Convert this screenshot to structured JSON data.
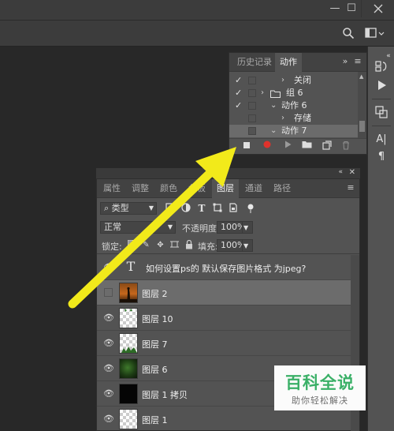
{
  "window": {
    "minimize": "—",
    "maximize": "☐"
  },
  "history_panel": {
    "tabs": [
      {
        "label": "历史记录"
      },
      {
        "label": "动作"
      }
    ],
    "active_tab": "动作",
    "rows": [
      {
        "checked": true,
        "arrow": "›",
        "label": "关闭",
        "selected": false
      },
      {
        "checked": true,
        "arrow": "›",
        "label": "组 6",
        "selected": false
      },
      {
        "checked": true,
        "arrow": "⌄",
        "label": "动作 6",
        "selected": false
      },
      {
        "checked": false,
        "arrow": "›",
        "label": "存储",
        "selected": false
      },
      {
        "checked": false,
        "arrow": "⌄",
        "label": "动作 7",
        "selected": true
      }
    ]
  },
  "layers_panel": {
    "tabs": [
      {
        "label": "属性"
      },
      {
        "label": "调整"
      },
      {
        "label": "颜色"
      },
      {
        "label": "色板"
      },
      {
        "label": "图层"
      },
      {
        "label": "通道"
      },
      {
        "label": "路径"
      }
    ],
    "active_tab": "图层",
    "kind_filter": "类型",
    "blend_mode": "正常",
    "opacity_label": "不透明度:",
    "opacity_value": "100%",
    "lock_label": "锁定:",
    "fill_label": "填充:",
    "fill_value": "100%",
    "layers": [
      {
        "name": "如何设置ps的 默认保存图片格式 为jpeg?",
        "type": "text",
        "visible": true,
        "selected": false
      },
      {
        "name": "图层 2",
        "type": "photo",
        "visible": false,
        "selected": true
      },
      {
        "name": "图层 10",
        "type": "checker",
        "visible": true,
        "selected": false
      },
      {
        "name": "图层 7",
        "type": "checker",
        "visible": true,
        "selected": false
      },
      {
        "name": "图层 6",
        "type": "green",
        "visible": true,
        "selected": false
      },
      {
        "name": "图层 1 拷贝",
        "type": "black",
        "visible": true,
        "selected": false
      },
      {
        "name": "图层 1",
        "type": "checker",
        "visible": true,
        "selected": false
      }
    ]
  },
  "watermark": {
    "title": "百科全说",
    "subtitle": "助你轻松解决"
  },
  "colors": {
    "arrow": "#f2ea1a",
    "record": "#e0322c",
    "watermark_green": "#3ab067"
  }
}
